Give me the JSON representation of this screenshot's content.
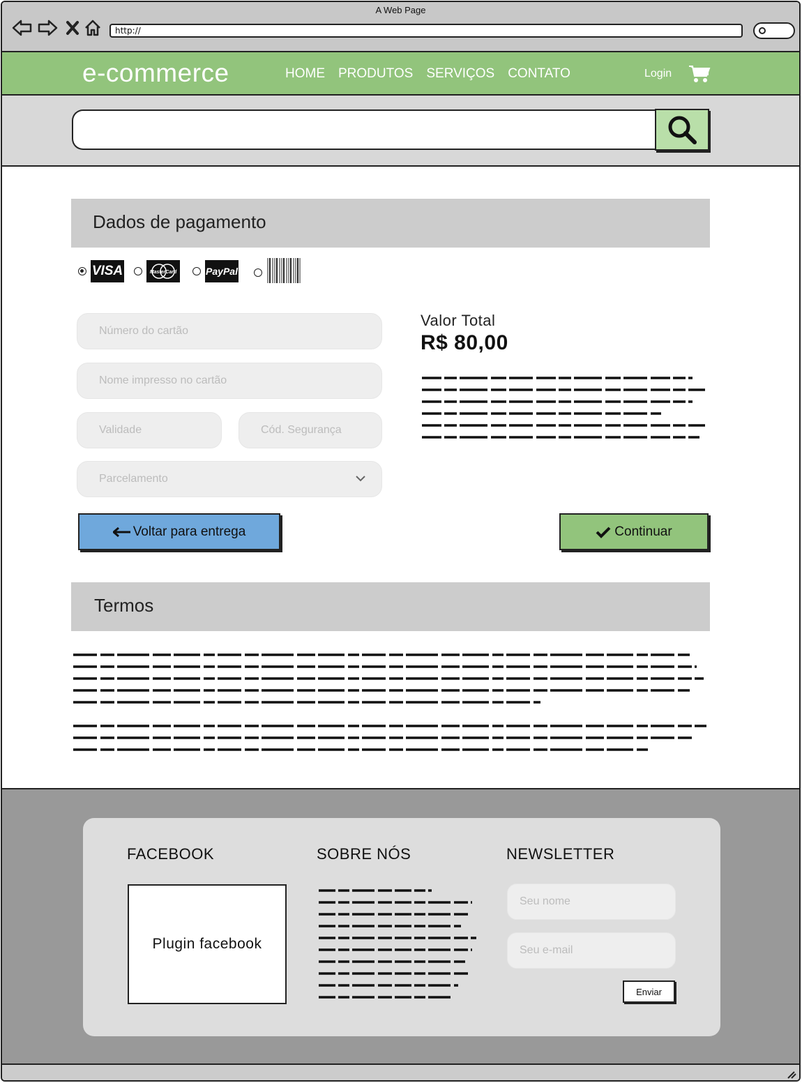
{
  "browser": {
    "title": "A Web Page",
    "url": "http://",
    "nav_icons": [
      "back-arrow-icon",
      "forward-arrow-icon",
      "close-icon",
      "home-icon"
    ]
  },
  "header": {
    "logo": "e-commerce",
    "menu": [
      "HOME",
      "PRODUTOS",
      "SERVIÇOS",
      "CONTATO"
    ],
    "login": "Login",
    "cart_icon": "shopping-cart-icon",
    "bg_color": "#92c47c"
  },
  "search": {
    "placeholder": "",
    "button_icon": "search-icon",
    "button_color": "#b9dfa9"
  },
  "payment": {
    "title": "Dados de pagamento",
    "methods": [
      {
        "label": "VISA",
        "selected": true
      },
      {
        "label": "MasterCard",
        "selected": false
      },
      {
        "label": "PayPal",
        "selected": false
      },
      {
        "label": "barcode",
        "selected": false
      }
    ],
    "fields": {
      "card_number": "Número do cartão",
      "card_name": "Nome impresso no cartão",
      "expiry": "Validade",
      "cvv": "Cód. Segurança",
      "installments": "Parcelamento"
    },
    "total_label": "Valor Total",
    "total_value": "R$ 80,00",
    "back_button": "Voltar para entrega",
    "continue_button": "Continuar",
    "back_color": "#6fa8dc",
    "continue_color": "#92c47c"
  },
  "terms": {
    "title": "Termos"
  },
  "footer": {
    "facebook_title": "FACEBOOK",
    "facebook_plugin": "Plugin facebook",
    "about_title": "SOBRE NÓS",
    "newsletter_title": "NEWSLETTER",
    "name_placeholder": "Seu nome",
    "email_placeholder": "Seu e-mail",
    "send_button": "Enviar",
    "bg_color": "#999999"
  }
}
